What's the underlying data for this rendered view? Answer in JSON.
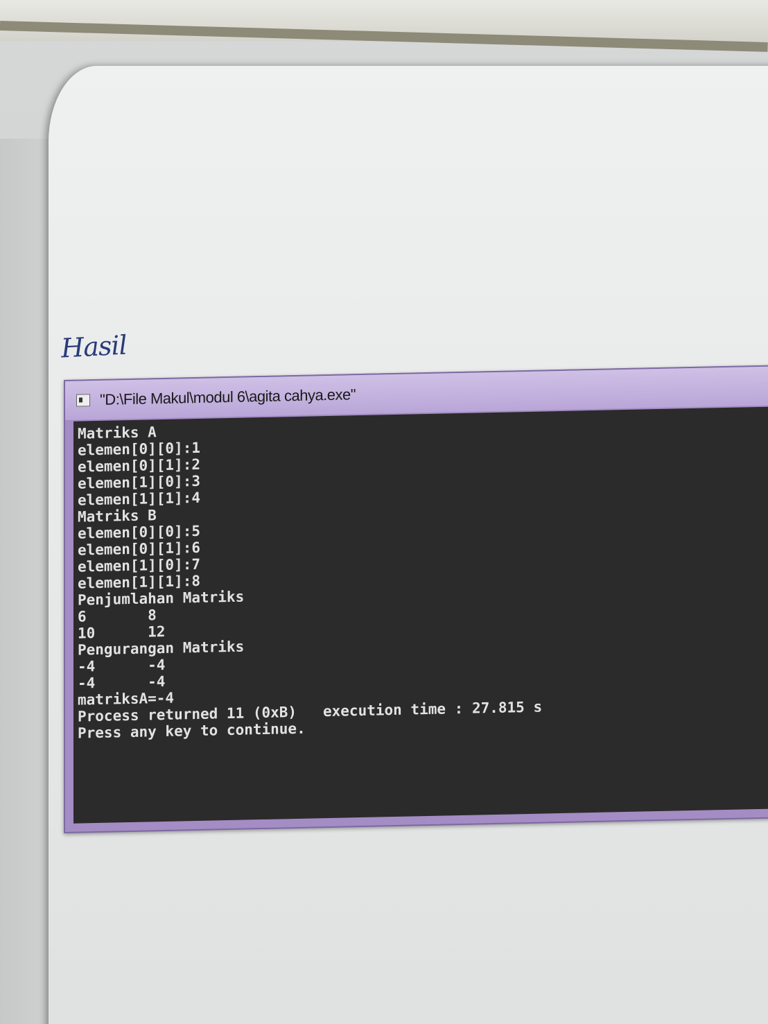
{
  "handwritten_note": "Hasil",
  "window": {
    "title": "\"D:\\File Makul\\modul 6\\agita cahya.exe\""
  },
  "console": {
    "lines": [
      "Matriks A",
      "elemen[0][0]:1",
      "elemen[0][1]:2",
      "elemen[1][0]:3",
      "elemen[1][1]:4",
      "Matriks B",
      "elemen[0][0]:5",
      "elemen[0][1]:6",
      "elemen[1][0]:7",
      "elemen[1][1]:8",
      "Penjumlahan Matriks",
      "6       8",
      "10      12",
      "Pengurangan Matriks",
      "-4      -4",
      "-4      -4",
      "matriksA=-4",
      "Process returned 11 (0xB)   execution time : 27.815 s",
      "Press any key to continue."
    ]
  },
  "colors": {
    "console_bg": "#2b2b2b",
    "console_text": "#e2e2e2",
    "window_frame": "#a48cc4",
    "handwriting_ink": "#2a3a7a"
  }
}
